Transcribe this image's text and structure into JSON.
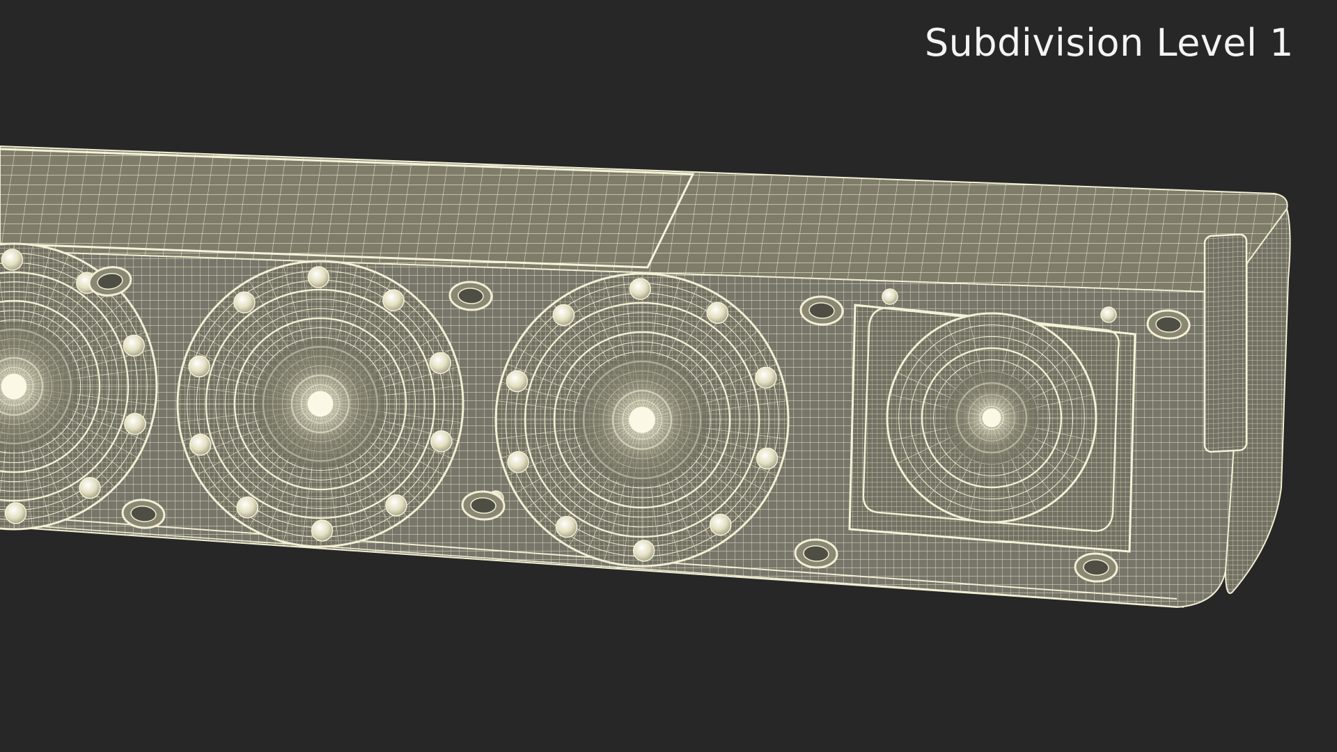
{
  "viewport": {
    "subdivision_label": "Subdivision Level 1"
  },
  "colors": {
    "background": "#272727",
    "mesh_fill": "#7d7b68",
    "mesh_fill_dark": "#6b6958",
    "wire": "#f3f0d6",
    "highlight": "#fbf8e6"
  },
  "model": {
    "subject": "soundbar wireframe",
    "speaker_drivers": 4
  }
}
